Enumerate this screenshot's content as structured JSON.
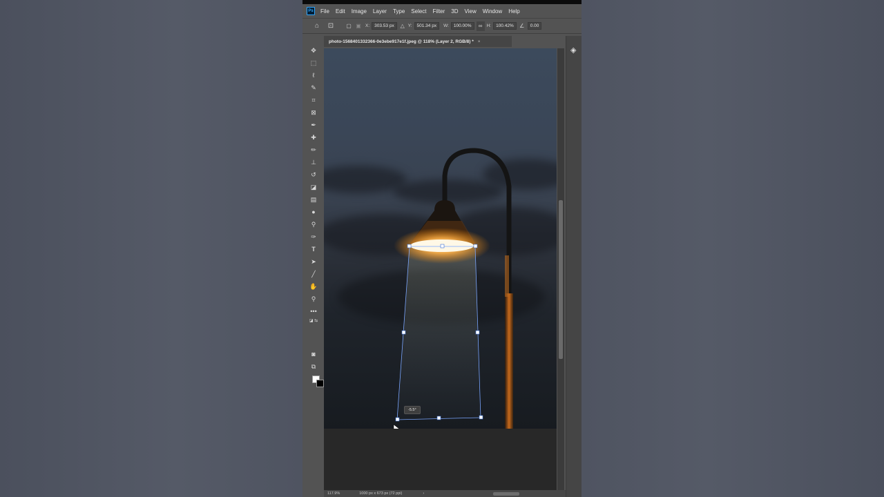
{
  "app": {
    "logo": "Ps"
  },
  "menu": [
    "File",
    "Edit",
    "Image",
    "Layer",
    "Type",
    "Select",
    "Filter",
    "3D",
    "View",
    "Window",
    "Help"
  ],
  "options": {
    "x_label": "X:",
    "x_value": "303.53 px",
    "y_label": "Y:",
    "y_value": "501.34 px",
    "w_label": "W:",
    "w_value": "100.00%",
    "h_label": "H:",
    "h_value": "100.42%",
    "angle_value": "0.00"
  },
  "document": {
    "tab_title": "photo-1568401332366-0e3ebe917e1f.jpeg @ 118% (Layer 2, RGB/8) *",
    "close": "×"
  },
  "transform": {
    "angle_readout": "-5.5°"
  },
  "status": {
    "zoom": "117.9%",
    "dimensions": "1000 px x 673 px (72 ppi)",
    "arrow": "›"
  },
  "tools": [
    "move-icon",
    "marquee-icon",
    "lasso-icon",
    "quick-select-icon",
    "crop-icon",
    "frame-icon",
    "eyedropper-icon",
    "healing-icon",
    "brush-icon",
    "stamp-icon",
    "history-brush-icon",
    "eraser-icon",
    "gradient-icon",
    "blur-icon",
    "dodge-icon",
    "pen-icon",
    "type-icon",
    "path-select-icon",
    "line-icon",
    "hand-icon",
    "zoom-icon",
    "more-icon"
  ],
  "colors": {
    "foreground": "#ffffff",
    "background": "#000000",
    "selection": "#4a7fd6"
  }
}
